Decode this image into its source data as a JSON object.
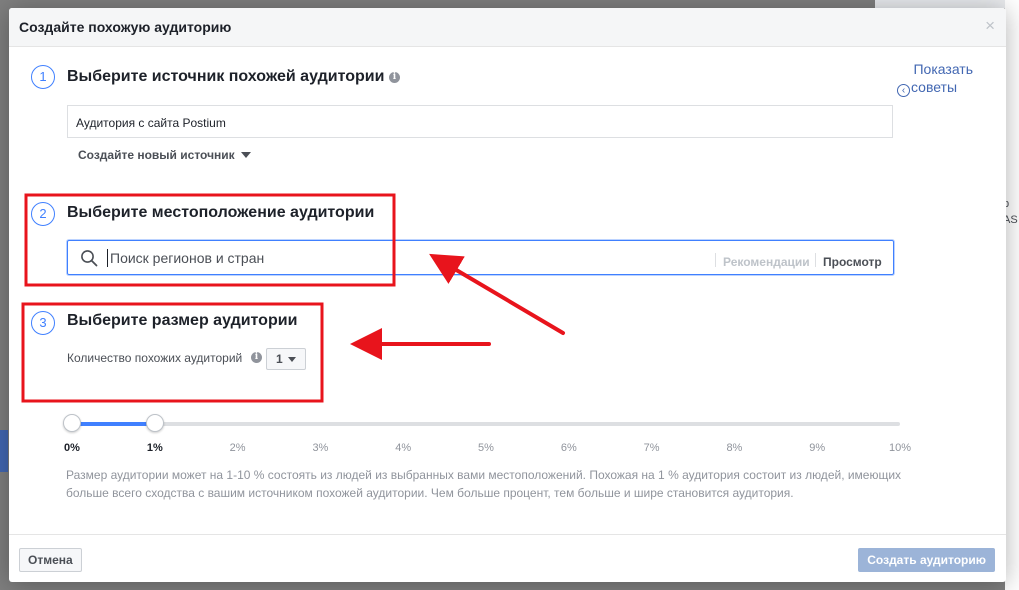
{
  "dialog": {
    "title": "Создайте похожую аудиторию",
    "close_glyph": "×"
  },
  "tips": {
    "line1": "Показать",
    "line2": "советы",
    "icon": "chevron-left-icon"
  },
  "step1": {
    "number": "1",
    "title": "Выберите источник похожей аудитории",
    "source_value": "Аудитория с сайта Postium",
    "new_source_label": "Создайте новый источник"
  },
  "step2": {
    "number": "2",
    "title": "Выберите местоположение аудитории",
    "search_placeholder": "Поиск регионов и стран",
    "recommendations_label": "Рекомендации",
    "browse_label": "Просмотр"
  },
  "step3": {
    "number": "3",
    "title": "Выберите размер аудитории",
    "count_label": "Количество похожих аудиторий",
    "count_value": "1"
  },
  "slider": {
    "ticks": [
      "0%",
      "1%",
      "2%",
      "3%",
      "4%",
      "5%",
      "6%",
      "7%",
      "8%",
      "9%",
      "10%"
    ],
    "range_start": 0,
    "range_end": 1,
    "max": 10
  },
  "description": "Размер аудитории может на 1-10 % состоять из людей из выбранных вами местоположений. Похожая на 1 % аудитория состоит из людей, имеющих больше всего сходства с вашим источником похожей аудитории. Чем больше процент, тем больше и шире становится аудитория.",
  "footer": {
    "cancel_label": "Отмена",
    "create_label": "Создать аудиторию"
  },
  "background": {
    "right_text_1": "р",
    "right_text_2": "AS"
  },
  "colors": {
    "accent": "#4080ff",
    "link": "#4267b2",
    "annotation": "#e8141c",
    "disabled_button": "#9cb4d8"
  }
}
